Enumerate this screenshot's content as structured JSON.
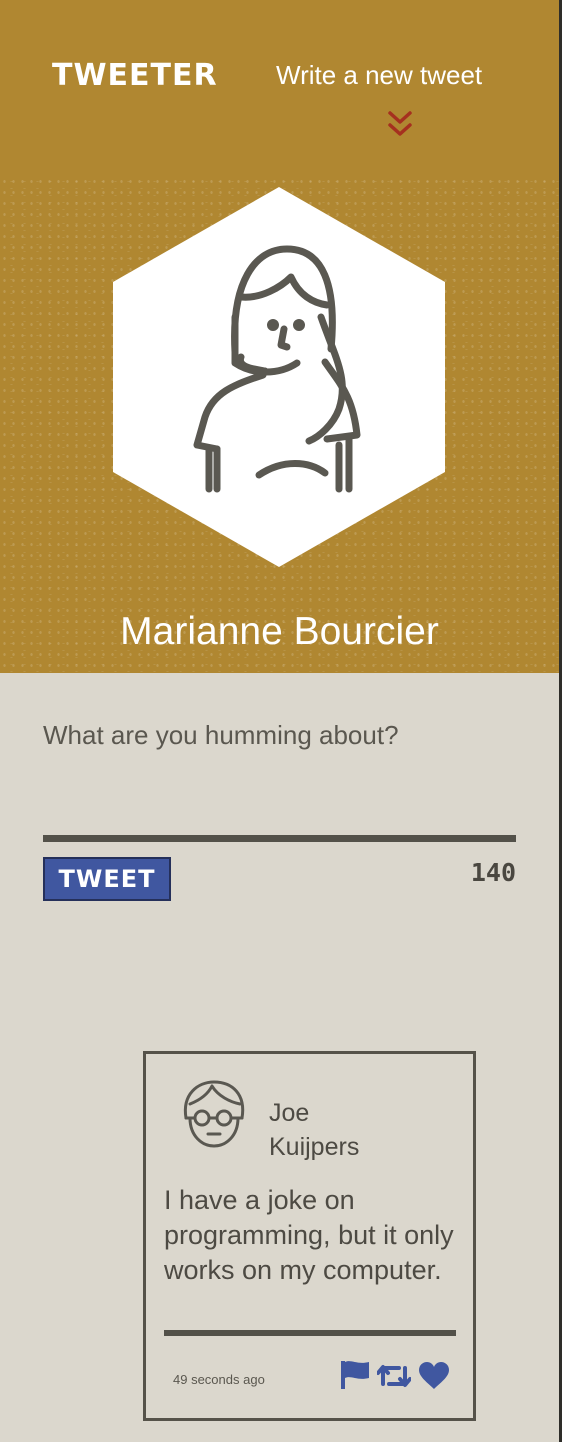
{
  "nav": {
    "brand": "TWEETER",
    "compose_link": "Write a new tweet"
  },
  "profile": {
    "name": "Marianne Bourcier"
  },
  "compose": {
    "placeholder": "What are you humming about?",
    "submit_label": "TWEET",
    "char_counter": "140"
  },
  "tweets": [
    {
      "author": "Joe Kuijpers",
      "text": "I have a joke on programming, but it only works on my computer.",
      "timestamp": "49 seconds ago",
      "actions": [
        "flag-icon",
        "retweet-icon",
        "heart-icon"
      ]
    }
  ],
  "colors": {
    "header_bg": "#b08731",
    "page_bg": "#dbd7cd",
    "accent_blue": "#4057a0",
    "chevron_red": "#a5301f",
    "text_dark": "#4d4a43"
  }
}
